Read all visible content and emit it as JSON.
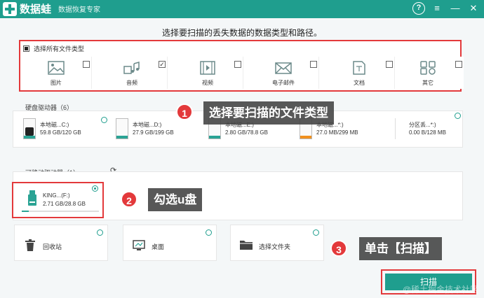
{
  "titlebar": {
    "app_name": "数据蛙",
    "subtitle": "数据恢复专家",
    "help": "?",
    "settings": "≡",
    "minimize": "—",
    "close": "✕"
  },
  "prompt": "选择要扫描的丢失数据的数据类型和路径。",
  "file_types": {
    "select_all_label": "选择所有文件类型",
    "items": [
      {
        "label": "图片",
        "icon": "image-icon",
        "checked": ""
      },
      {
        "label": "音频",
        "icon": "music-icon",
        "checked": "✓"
      },
      {
        "label": "视频",
        "icon": "video-icon",
        "checked": ""
      },
      {
        "label": "电子邮件",
        "icon": "mail-icon",
        "checked": ""
      },
      {
        "label": "文档",
        "icon": "document-icon",
        "checked": ""
      },
      {
        "label": "其它",
        "icon": "other-icon",
        "checked": ""
      }
    ]
  },
  "hard_drives": {
    "label": "硬盘驱动器（6）",
    "items": [
      {
        "name": "本地磁...C:)",
        "size": "59.8 GB/120 GB",
        "bar_color": "#2aa394",
        "usage": 0.5
      },
      {
        "name": "本地磁...D:)",
        "size": "27.9 GB/199 GB",
        "bar_color": "#2aa394",
        "usage": 0.14
      },
      {
        "name": "本地磁...E:)",
        "size": "2.80 GB/78.8 GB",
        "bar_color": "#2aa394",
        "usage": 0.04
      },
      {
        "name": "本地磁...*:)",
        "size": "27.0 MB/299 MB",
        "bar_color": "#f0901e",
        "usage": 0.09
      },
      {
        "name": "分区丢...*:)",
        "size": "0.00  B/128 MB",
        "bar_color": "#cccccc",
        "usage": 0.0
      }
    ]
  },
  "removable": {
    "label": "可移动驱动器（1）",
    "item": {
      "name": "KING...(F:)",
      "size": "2.71 GB/28.8 GB",
      "usage": 0.09
    }
  },
  "locations": [
    {
      "label": "回收站",
      "icon": "trash-icon"
    },
    {
      "label": "桌面",
      "icon": "desktop-icon"
    },
    {
      "label": "选择文件夹",
      "icon": "folder-icon"
    }
  ],
  "callouts": {
    "step1": {
      "num": "1",
      "text": "选择要扫描的文件类型"
    },
    "step2": {
      "num": "2",
      "text": "勾选u盘"
    },
    "step3": {
      "num": "3",
      "text": "单击【扫描】"
    }
  },
  "scan_button": "扫描",
  "watermark": "@稀土掘金技术社区"
}
